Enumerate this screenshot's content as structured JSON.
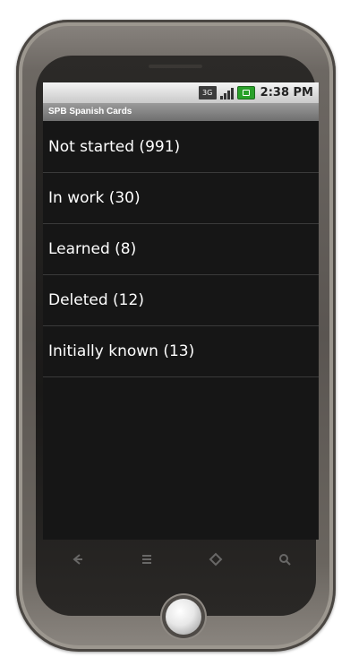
{
  "statusbar": {
    "network_label": "3G",
    "time": "2:38 PM",
    "icons": [
      "3g-icon",
      "signal-icon",
      "battery-icon"
    ]
  },
  "app": {
    "title": "SPB Spanish Cards"
  },
  "list": {
    "items": [
      {
        "label": "Not started (991)"
      },
      {
        "label": "In work (30)"
      },
      {
        "label": "Learned (8)"
      },
      {
        "label": "Deleted (12)"
      },
      {
        "label": "Initially known (13)"
      }
    ]
  },
  "navbar": {
    "icons": [
      "back-icon",
      "menu-icon",
      "home-icon",
      "search-icon"
    ]
  },
  "colors": {
    "screen_bg": "#161616",
    "titlebar_bg": "#7f7f7f",
    "battery": "#2aa12a"
  }
}
